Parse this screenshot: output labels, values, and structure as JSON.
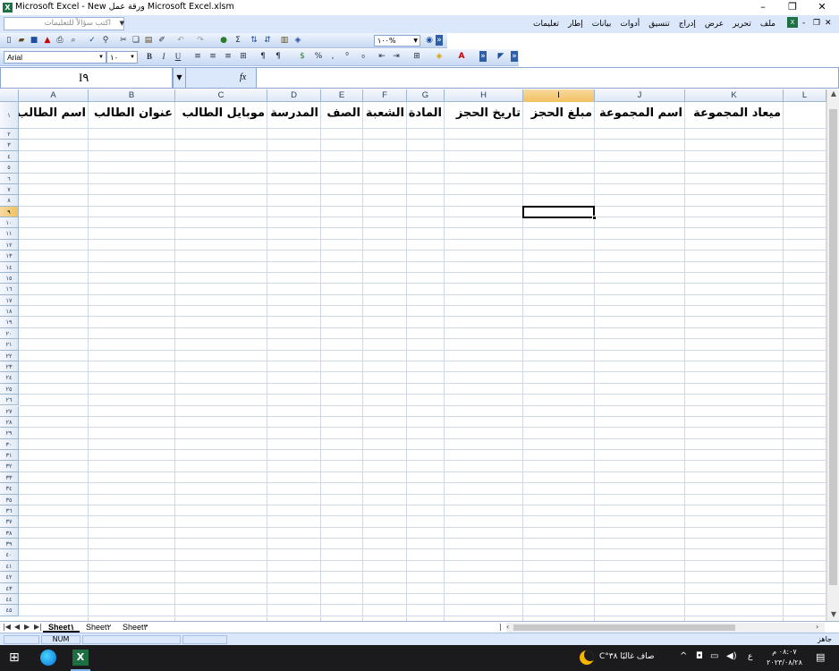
{
  "window": {
    "title": "Microsoft Excel - New ورقة عمل Microsoft Excel.xlsm",
    "minimize": "–",
    "restore": "❐",
    "close": "✕"
  },
  "menubar": {
    "help_placeholder": "اكتب سؤالاً للتعليمات",
    "items": [
      "ملف",
      "تحرير",
      "عرض",
      "إدراج",
      "تنسيق",
      "أدوات",
      "بيانات",
      "إطار",
      "تعليمات"
    ]
  },
  "toolbar": {
    "zoom": "١٠٠%",
    "font_name": "Arial",
    "font_size": "١٠"
  },
  "formula": {
    "name_box": "I٩",
    "fx": "fx",
    "content": ""
  },
  "columns": [
    "A",
    "B",
    "C",
    "D",
    "E",
    "F",
    "G",
    "H",
    "I",
    "J",
    "K",
    "L"
  ],
  "selected_column": "I",
  "rows": [
    "١",
    "٢",
    "٣",
    "٤",
    "٥",
    "٦",
    "٧",
    "٨",
    "٩",
    "١٠",
    "١١",
    "١٢",
    "١٣",
    "١٤",
    "١٥",
    "١٦",
    "١٧",
    "١٨",
    "١٩",
    "٢٠",
    "٢١",
    "٢٢",
    "٢٣",
    "٢٤",
    "٢٥",
    "٢٦",
    "٢٧",
    "٢٨",
    "٢٩",
    "٣٠",
    "٣١",
    "٣٢",
    "٣٣",
    "٣٤",
    "٣٥",
    "٣٦",
    "٣٧",
    "٣٨",
    "٣٩",
    "٤٠",
    "٤١",
    "٤٢",
    "٤٣",
    "٤٤",
    "٤٥"
  ],
  "selected_row": "٩",
  "header_row": {
    "A": "اسم الطالب",
    "B": "عنوان الطالب",
    "C": "موبايل الطالب",
    "D": "المدرسة",
    "E": "الصف",
    "F": "الشعبة",
    "G": "المادة",
    "H": "تاريخ الحجز",
    "I": "مبلغ الحجز",
    "J": "اسم المجموعة",
    "K": "ميعاد المجموعة"
  },
  "sheets": [
    "Sheet١",
    "Sheet٢",
    "Sheet٣"
  ],
  "active_sheet": "Sheet١",
  "status": {
    "num": "NUM",
    "ready": "جاهز"
  },
  "taskbar": {
    "weather": "صاف غالبًا ٣٨°C",
    "lang": "ع",
    "time": "٠٨:٠٧ م",
    "date": "٢٠٢٣/٠٨/٢٨"
  },
  "colors": {
    "accent": "#dbe7fb",
    "selected_header": "#f1c15f",
    "grid": "#d0d7e5",
    "taskbar": "#1b1b1e",
    "excel_green": "#1d6f42"
  }
}
